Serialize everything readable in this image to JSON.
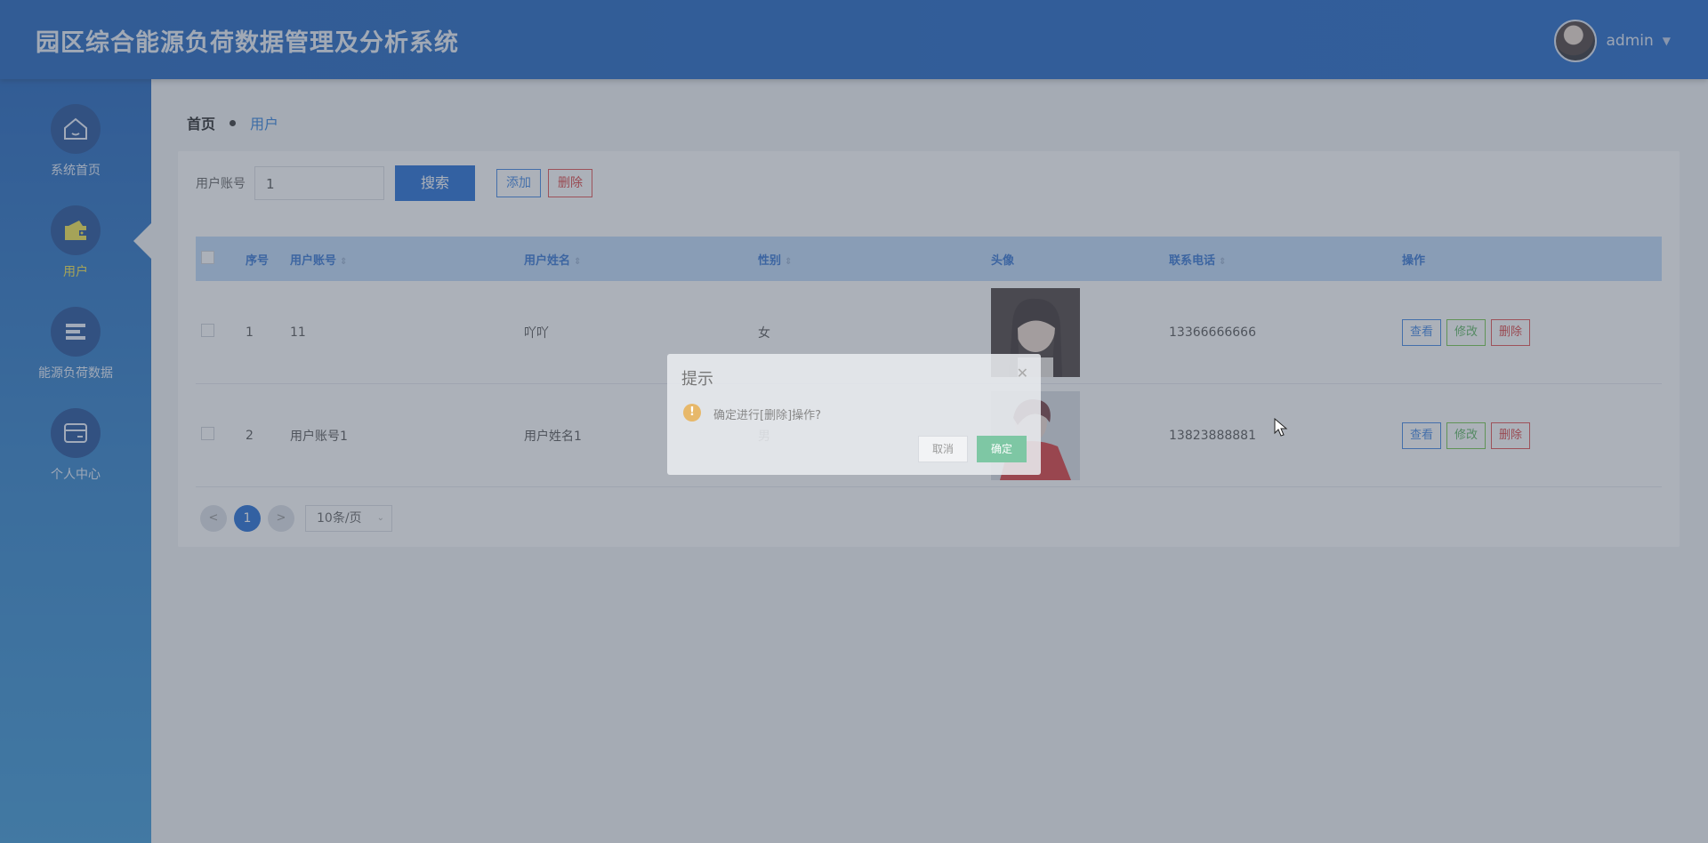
{
  "app": {
    "title": "园区综合能源负荷数据管理及分析系统"
  },
  "user": {
    "name": "admin"
  },
  "sidebar": {
    "items": [
      {
        "label": "系统首页",
        "icon": "home-icon",
        "active": false
      },
      {
        "label": "用户",
        "icon": "wallet-icon",
        "active": true
      },
      {
        "label": "能源负荷数据",
        "icon": "list-icon",
        "active": false
      },
      {
        "label": "个人中心",
        "icon": "card-icon",
        "active": false
      }
    ]
  },
  "breadcrumb": {
    "home": "首页",
    "current": "用户"
  },
  "search": {
    "label": "用户账号",
    "value": "1",
    "search_button": "搜索",
    "add_button": "添加",
    "delete_button": "删除"
  },
  "table": {
    "columns": [
      "序号",
      "用户账号",
      "用户姓名",
      "性别",
      "头像",
      "联系电话",
      "操作"
    ],
    "rows": [
      {
        "no": "1",
        "account": "11",
        "name": "吖吖",
        "gender": "女",
        "phone": "13366666666"
      },
      {
        "no": "2",
        "account": "用户账号1",
        "name": "用户姓名1",
        "gender": "男",
        "phone": "13823888881"
      }
    ],
    "actions": {
      "view": "查看",
      "edit": "修改",
      "delete": "删除"
    }
  },
  "pagination": {
    "prev": "<",
    "page": "1",
    "next": ">",
    "page_size": "10条/页"
  },
  "dialog": {
    "title": "提示",
    "message": "确定进行[删除]操作?",
    "cancel": "取消",
    "confirm": "确定"
  },
  "colors": {
    "primary": "#0d5fd1",
    "header": "#0b55b6",
    "active_nav": "#f0e23c",
    "danger": "#d83030",
    "success": "#4caf50"
  }
}
